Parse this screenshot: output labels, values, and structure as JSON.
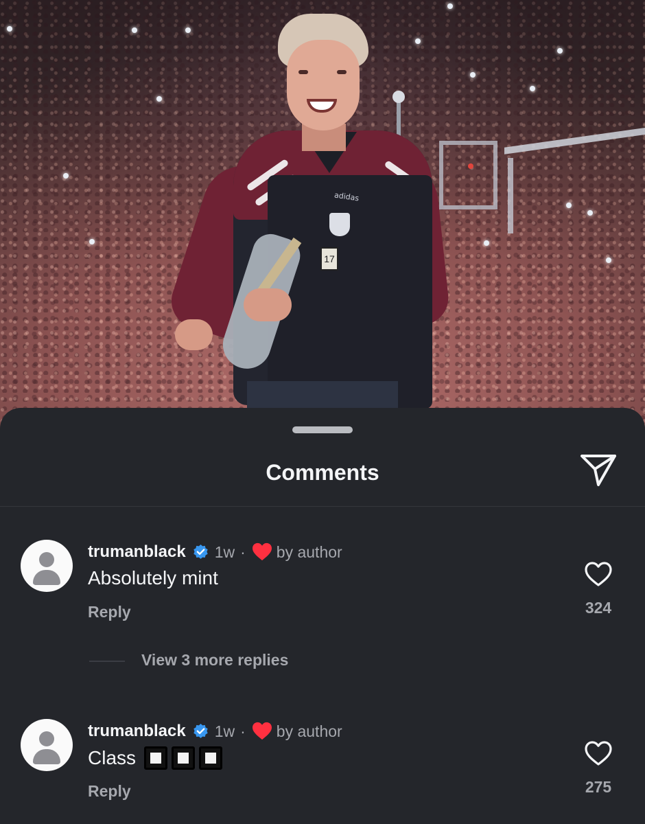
{
  "sheet": {
    "title": "Comments",
    "share_icon": "paper-plane-icon"
  },
  "comments": [
    {
      "username": "trumanblack",
      "verified": true,
      "time": "1w",
      "separator": "·",
      "liked_by_author_label": "by author",
      "text": "Absolutely mint",
      "reply_label": "Reply",
      "like_count": "324"
    },
    {
      "username": "trumanblack",
      "verified": true,
      "time": "1w",
      "separator": "·",
      "liked_by_author_label": "by author",
      "text": "Class",
      "emoji_count": 3,
      "reply_label": "Reply",
      "like_count": "275"
    }
  ],
  "view_more_replies": "View 3 more replies",
  "colors": {
    "sheet_bg": "#24262b",
    "text_primary": "#f4f5f7",
    "text_secondary": "#a6a8ae",
    "verified_blue": "#3897f0",
    "heart_red": "#ff3040"
  }
}
